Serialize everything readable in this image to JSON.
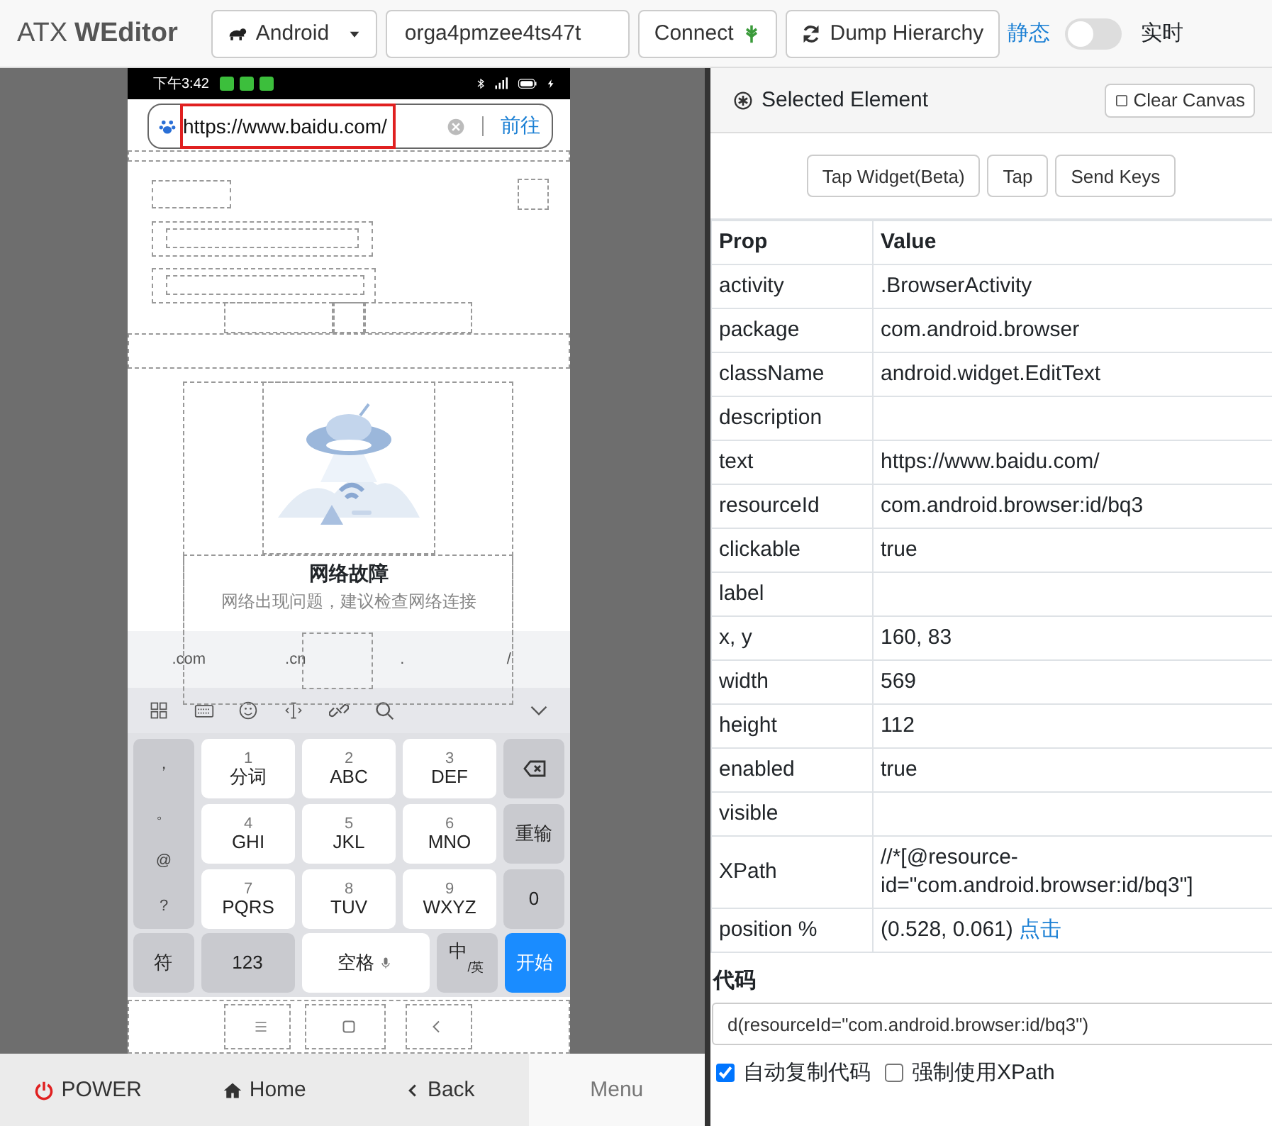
{
  "toolbar": {
    "title_prefix": "ATX",
    "title": "WEditor",
    "platform": "Android",
    "serial": "orga4pmzee4ts47t",
    "connect_button": "Connect",
    "dump_button": "Dump Hierarchy",
    "static_label": "静态",
    "realtime_on": false,
    "realtime_label": "实时"
  },
  "phone": {
    "status_time": "下午3:42",
    "url": "https://www.baidu.com/",
    "go_button": "前往",
    "error_title": "网络故障",
    "error_message": "网络出现问题，建议检查网络连接",
    "suggestions": [
      ".com",
      ".cn",
      ".",
      "/"
    ],
    "symbols": [
      "，",
      "。",
      "@",
      "?"
    ],
    "keys": [
      {
        "digit": "1",
        "letters": "分词"
      },
      {
        "digit": "2",
        "letters": "ABC"
      },
      {
        "digit": "3",
        "letters": "DEF"
      },
      {
        "digit": "4",
        "letters": "GHI"
      },
      {
        "digit": "5",
        "letters": "JKL"
      },
      {
        "digit": "6",
        "letters": "MNO"
      },
      {
        "digit": "7",
        "letters": "PQRS"
      },
      {
        "digit": "8",
        "letters": "TUV"
      },
      {
        "digit": "9",
        "letters": "WXYZ"
      }
    ],
    "reset_key": "重输",
    "zero_key": "0",
    "symbol_key": "符",
    "number_key": "123",
    "space_key": "空格",
    "lang_key": "中",
    "lang_alt": "/英",
    "enter_key": "开始"
  },
  "nav_buttons": [
    {
      "label": "POWER",
      "kind": "power"
    },
    {
      "label": "Home",
      "kind": "home"
    },
    {
      "label": "Back",
      "kind": "back"
    },
    {
      "label": "Menu",
      "kind": "menu"
    }
  ],
  "inspector": {
    "title": "Selected Element",
    "clear_button": "Clear Canvas",
    "actions": [
      "Tap Widget(Beta)",
      "Tap",
      "Send Keys"
    ],
    "columns": [
      "Prop",
      "Value"
    ],
    "rows": [
      {
        "prop": "activity",
        "value": ".BrowserActivity"
      },
      {
        "prop": "package",
        "value": "com.android.browser"
      },
      {
        "prop": "className",
        "value": "android.widget.EditText"
      },
      {
        "prop": "description"
      },
      {
        "prop": "text",
        "value": "https://www.baidu.com/"
      },
      {
        "prop": "resourceId",
        "value": "com.android.browser:id/bq3"
      },
      {
        "prop": "clickable",
        "value": "true"
      },
      {
        "prop": "label"
      },
      {
        "prop": "x, y",
        "value": "160, 83"
      },
      {
        "prop": "width",
        "value": "569"
      },
      {
        "prop": "height",
        "value": "112"
      },
      {
        "prop": "enabled",
        "value": "true"
      },
      {
        "prop": "visible"
      },
      {
        "prop": "XPath",
        "value": "//*[@resource-id=\"com.android.browser:id/bq3\"]"
      },
      {
        "prop": "position %",
        "value": "(0.528, 0.061)",
        "link": "点击"
      }
    ],
    "code_label": "代码",
    "code": "d(resourceId=\"com.android.browser:id/bq3\")",
    "options": [
      {
        "label": "自动复制代码",
        "checked": true
      },
      {
        "label": "强制使用XPath",
        "checked": false
      }
    ]
  }
}
